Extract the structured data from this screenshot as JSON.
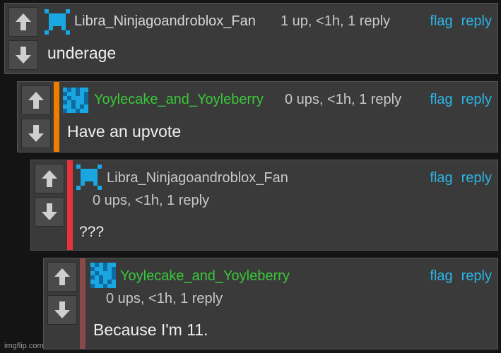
{
  "colors": {
    "link": "#2bb5e8",
    "username_gray": "#d8d8d8",
    "username_green": "#39c83a",
    "accent_orange": "#f07d00",
    "accent_red": "#e8323c",
    "accent_brown": "#8a4a4a"
  },
  "icons": {
    "upvote": "arrow-up-icon",
    "downvote": "arrow-down-icon",
    "avatar": "pixel-avatar-icon"
  },
  "comments": [
    {
      "username": "Libra_Ninjagoandroblox_Fan",
      "meta": "1 up, <1h, 1 reply",
      "flag": "flag",
      "reply": "reply",
      "text": "underage"
    },
    {
      "username": "Yoylecake_and_Yoyleberry",
      "meta": "0 ups, <1h, 1 reply",
      "flag": "flag",
      "reply": "reply",
      "text": "Have an upvote"
    },
    {
      "username": "Libra_Ninjagoandroblox_Fan",
      "meta": "0 ups, <1h, 1 reply",
      "flag": "flag",
      "reply": "reply",
      "text": "???"
    },
    {
      "username": "Yoylecake_and_Yoyleberry",
      "meta": "0 ups, <1h, 1 reply",
      "flag": "flag",
      "reply": "reply",
      "text": "Because I'm 11."
    }
  ],
  "watermark": "imgflip.com"
}
